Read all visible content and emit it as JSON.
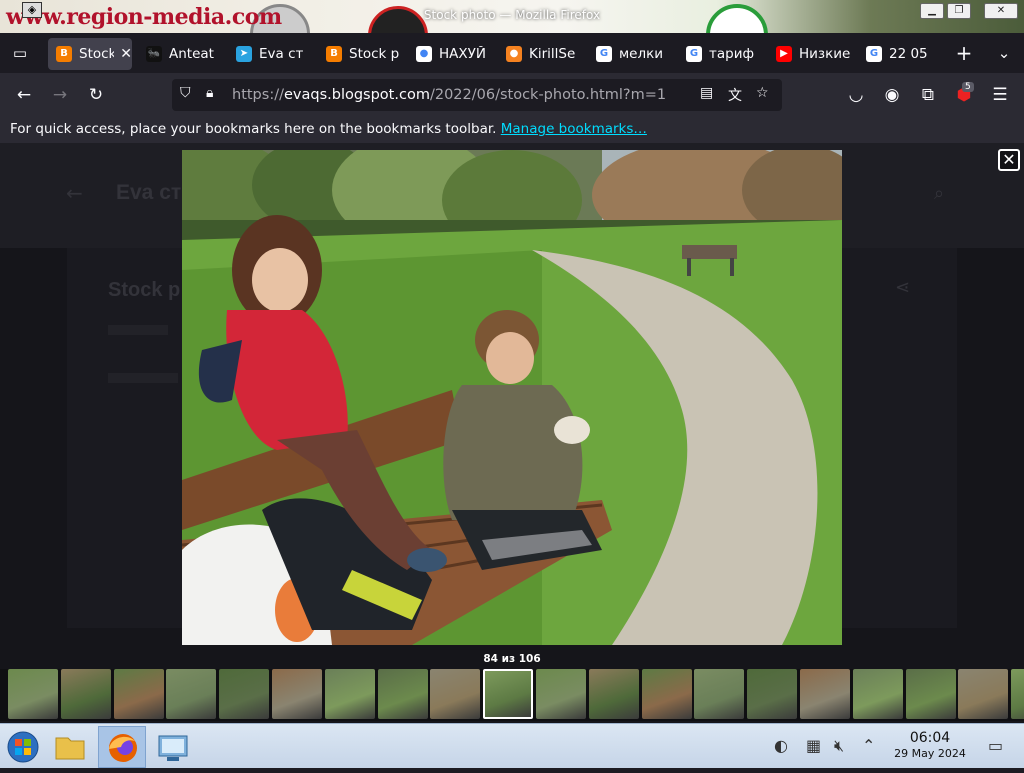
{
  "window": {
    "title": "Stock photo — Mozilla Firefox",
    "banner_text": "www.region-media.com",
    "buttons": {
      "minimize": "▁",
      "maximize": "❐",
      "close": "✕"
    }
  },
  "tabs": [
    {
      "label": "Stock",
      "icon": "blogger-icon",
      "color": "#f57d00",
      "glyph": "B",
      "active": true
    },
    {
      "label": "Anteat",
      "icon": "anteater-icon",
      "color": "#111111",
      "glyph": "🐜",
      "active": false
    },
    {
      "label": "Eva ст",
      "icon": "telegram-icon",
      "color": "#2aa3e0",
      "glyph": "➤",
      "active": false
    },
    {
      "label": "Stock р",
      "icon": "blogger-icon",
      "color": "#f57d00",
      "glyph": "B",
      "active": false
    },
    {
      "label": "НАХУЙ",
      "icon": "github-icon",
      "color": "#ffffff",
      "glyph": "●",
      "active": false
    },
    {
      "label": "KirillSe",
      "icon": "site-icon",
      "color": "#f58220",
      "glyph": "●",
      "active": false
    },
    {
      "label": "мелки",
      "icon": "google-icon",
      "color": "#ffffff",
      "glyph": "G",
      "active": false
    },
    {
      "label": "тариф",
      "icon": "google-icon",
      "color": "#ffffff",
      "glyph": "G",
      "active": false
    },
    {
      "label": "Низкие",
      "icon": "youtube-icon",
      "color": "#ff0000",
      "glyph": "▶",
      "active": false
    },
    {
      "label": "22 05",
      "icon": "google-icon",
      "color": "#ffffff",
      "glyph": "G",
      "active": false
    }
  ],
  "nav": {
    "url_prefix": "https://",
    "url_host": "evaqs.blogspot.com",
    "url_path": "/2022/06/stock-photo.html?m=1",
    "extension_badge": "5"
  },
  "bookmarks": {
    "text": "For quick access, place your bookmarks here on the bookmarks toolbar.",
    "link": "Manage bookmarks…"
  },
  "lightbox": {
    "counter": "84 из 106",
    "thumb_count": 20,
    "current_index": 9
  },
  "taskbar": {
    "time": "06:04",
    "date": "29 May 2024"
  },
  "colors": {
    "accent": "#00ddff",
    "toolbar": "#2b2a33",
    "tabbar": "#1c1b22"
  }
}
